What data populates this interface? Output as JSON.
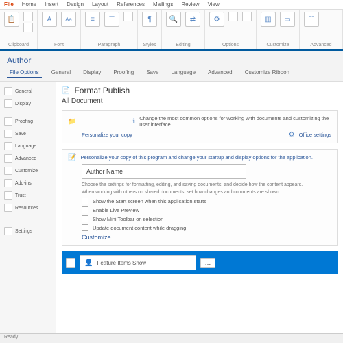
{
  "ribbon_tabs": [
    "File",
    "Home",
    "Insert",
    "Design",
    "Layout",
    "References",
    "Mailings",
    "Review",
    "View"
  ],
  "groups": {
    "g1": "Clipboard",
    "g2": "Font",
    "g3": "Paragraph",
    "g4": "Styles",
    "g5": "Editing",
    "g6": "Options",
    "g7": "Customize",
    "g8": "Advanced"
  },
  "subtitle": "Author",
  "subtabs": [
    "File Options",
    "General",
    "Display",
    "Proofing",
    "Save",
    "Language",
    "Advanced",
    "Customize Ribbon"
  ],
  "side": {
    "s1": "General",
    "s2": "Display",
    "s3": "Proofing",
    "s4": "Save",
    "s5": "Language",
    "s6": "Advanced",
    "s7": "Customize",
    "s8": "Add-ins",
    "s9": "Trust",
    "s10": "Resources",
    "s11": "Settings"
  },
  "content": {
    "heading": "Format Publish",
    "sub": "All Document",
    "card_info": "Change the most common options for working with documents and customizing the user interface.",
    "card_link1": "Personalize your copy",
    "card_link2": "Office settings",
    "section_title": "Personalize your copy of this program and change your startup and display options for the application.",
    "input_label": "Author Name",
    "check1": "Show the Start screen when this application starts",
    "check2": "Enable Live Preview",
    "check3": "Show Mini Toolbar on selection",
    "check4": "Update document content while dragging",
    "small1": "Choose the settings for formatting, editing, and saving documents, and decide how the content appears.",
    "small2": "When working with others on shared documents, set how changes and comments are shown.",
    "morelink": "Customize",
    "highlight_label": "Feature Items Show",
    "highlight_btn": "…"
  },
  "footer": "Ready"
}
